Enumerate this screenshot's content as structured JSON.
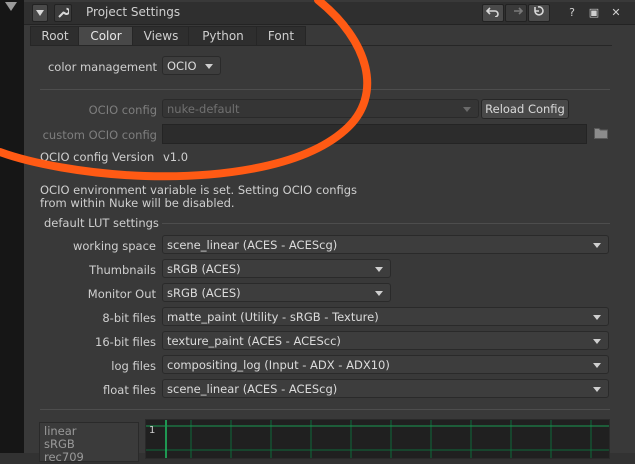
{
  "window": {
    "title": "Project Settings",
    "controls": [
      "?",
      "▣",
      "✕"
    ]
  },
  "tabs": [
    "Root",
    "Color",
    "Views",
    "Python",
    "Font"
  ],
  "active_tab": "Color",
  "color_management": {
    "label": "color management",
    "value": "OCIO"
  },
  "ocio": {
    "config_label": "OCIO config",
    "config_value": "nuke-default",
    "reload_label": "Reload Config",
    "custom_label": "custom OCIO config",
    "custom_value": "",
    "version_label": "OCIO config Version",
    "version_value": "v1.0",
    "env_message_line1": "OCIO environment variable is set. Setting OCIO configs",
    "env_message_line2": "from within Nuke will be disabled."
  },
  "lut": {
    "section_title": "default LUT settings",
    "rows": [
      {
        "label": "working space",
        "value": "scene_linear (ACES - ACEScg)"
      },
      {
        "label": "Thumbnails",
        "value": "sRGB (ACES)"
      },
      {
        "label": "Monitor Out",
        "value": "sRGB (ACES)"
      },
      {
        "label": "8-bit files",
        "value": "matte_paint (Utility - sRGB - Texture)"
      },
      {
        "label": "16-bit files",
        "value": "texture_paint (ACES - ACEScc)"
      },
      {
        "label": "log files",
        "value": "compositing_log (Input - ADX - ADX10)"
      },
      {
        "label": "float files",
        "value": "scene_linear (ACES - ACEScg)"
      }
    ]
  },
  "curves": {
    "items": [
      "linear",
      "sRGB",
      "rec709"
    ],
    "axis_label": "1"
  },
  "colors": {
    "overlay_ring": "#ff5a14",
    "curve_grid": "#0e6a3a",
    "curve_axis": "#1fbf63"
  }
}
